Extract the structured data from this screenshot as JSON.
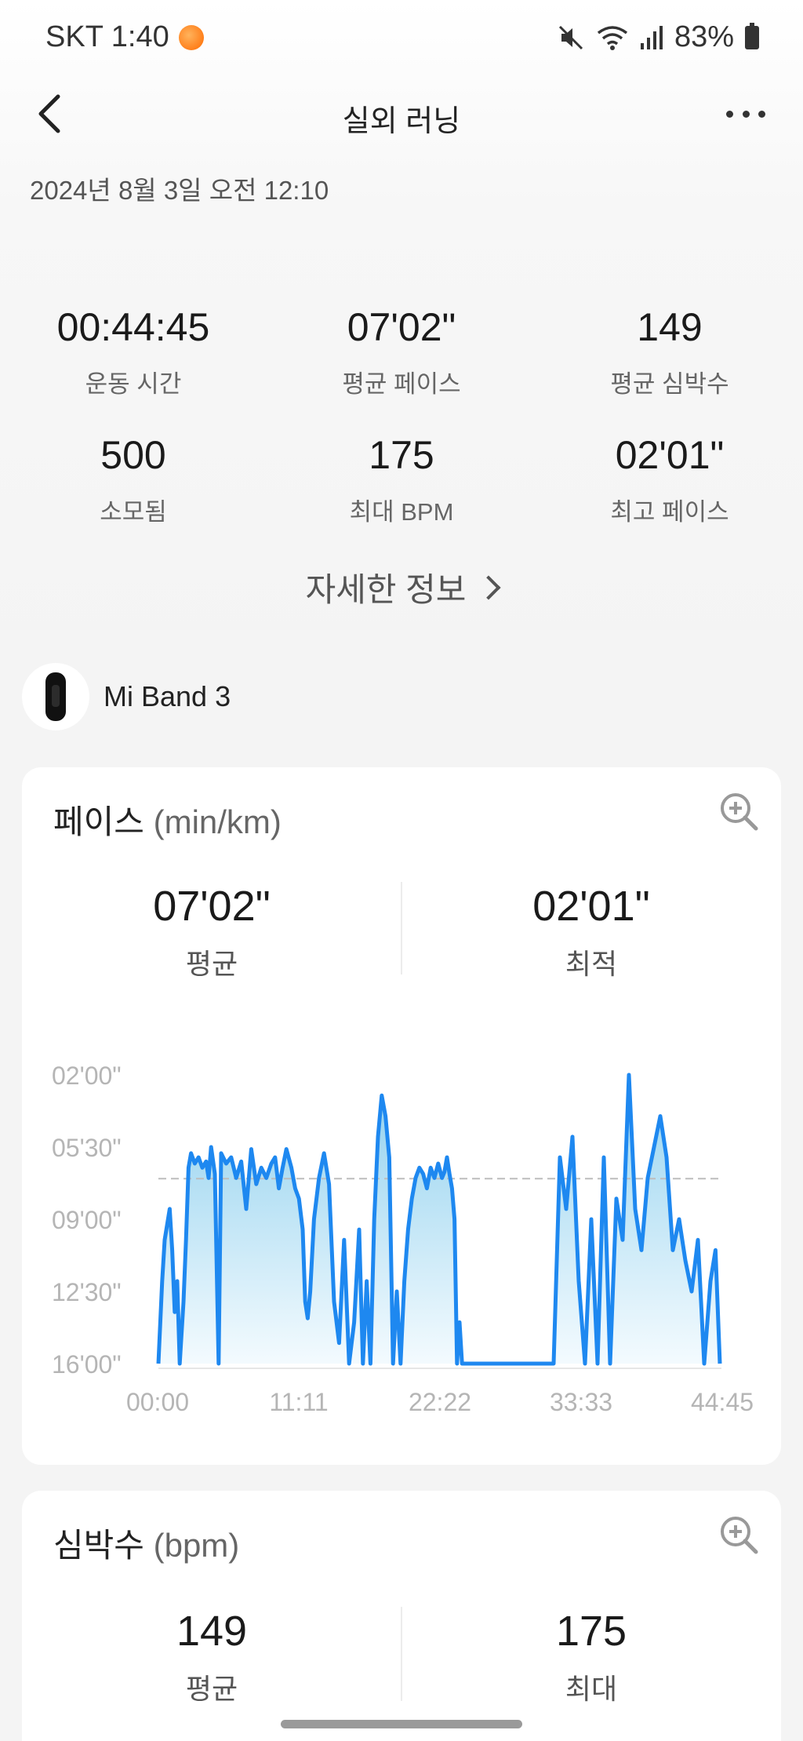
{
  "status_bar": {
    "carrier_time": "SKT 1:40",
    "battery": "83%"
  },
  "header": {
    "title": "실외 러닝"
  },
  "session": {
    "date": "2024년 8월 3일 오전 12:10"
  },
  "summary": [
    {
      "value": "00:44:45",
      "label": "운동 시간"
    },
    {
      "value": "07'02\"",
      "label": "평균 페이스"
    },
    {
      "value": "149",
      "label": "평균 심박수"
    },
    {
      "value": "500",
      "label": "소모됨"
    },
    {
      "value": "175",
      "label": "최대 BPM"
    },
    {
      "value": "02'01\"",
      "label": "최고 페이스"
    }
  ],
  "details_link": "자세한 정보",
  "device": {
    "name": "Mi Band 3"
  },
  "pace_card": {
    "title": "페이스",
    "unit": "(min/km)",
    "average": {
      "value": "07'02\"",
      "label": "평균"
    },
    "best": {
      "value": "02'01\"",
      "label": "최적"
    }
  },
  "hr_card": {
    "title": "심박수",
    "unit": "(bpm)",
    "average": {
      "value": "149",
      "label": "평균"
    },
    "max": {
      "value": "175",
      "label": "최대"
    }
  },
  "chart_data": {
    "type": "area",
    "xlabel": "",
    "ylabel": "",
    "x_tick_labels": [
      "00:00",
      "11:11",
      "22:22",
      "33:33",
      "44:45"
    ],
    "y_tick_labels": [
      "02'00\"",
      "05'30\"",
      "09'00\"",
      "12'30\"",
      "16'00\""
    ],
    "y_axis_reversed": true,
    "ylim_minutes_per_km": [
      2.0,
      16.0
    ],
    "xlim_minutes": [
      0,
      44.75
    ],
    "average_line_minutes_per_km": 7.03,
    "colors": {
      "line": "#1e88f0",
      "fill_top": "#8fd0ee",
      "fill_bottom": "#f2fafe",
      "average": "#bdbdbd"
    },
    "series": [
      {
        "x": [
          0.0,
          0.3,
          0.5,
          0.9,
          1.1,
          1.3,
          1.5,
          1.7,
          2.0,
          2.2,
          2.4,
          2.6,
          2.9,
          3.2,
          3.5,
          3.8,
          4.0,
          4.2,
          4.5,
          4.8,
          5.0,
          5.4,
          5.8,
          6.2,
          6.6,
          7.0,
          7.4,
          7.8,
          8.2,
          8.6,
          9.0,
          9.3,
          9.6,
          9.9,
          10.2,
          10.6,
          10.9,
          11.2,
          11.5,
          11.7,
          11.9,
          12.1,
          12.4,
          12.8,
          13.2,
          13.6,
          14.0,
          14.4,
          14.8,
          15.2,
          15.6,
          16.0,
          16.3,
          16.6,
          16.9,
          17.2,
          17.5,
          17.8,
          18.1,
          18.4,
          18.7,
          19.0,
          19.3,
          19.6,
          19.9,
          20.2,
          20.5,
          20.8,
          21.1,
          21.4,
          21.7,
          22.0,
          22.3,
          22.6,
          22.8,
          23.0,
          23.2,
          23.4,
          23.6,
          23.8,
          24.0,
          24.2,
          24.4,
          24.6,
          24.8,
          25.0,
          25.2
        ],
        "y": [
          16.0,
          12.0,
          10.0,
          8.5,
          10.5,
          13.5,
          12.0,
          16.0,
          13.0,
          10.0,
          6.5,
          5.8,
          6.3,
          6.0,
          6.5,
          6.2,
          7.0,
          5.5,
          6.8,
          16.0,
          5.8,
          6.3,
          6.0,
          7.0,
          6.2,
          8.5,
          5.6,
          7.3,
          6.5,
          7.0,
          6.3,
          6.0,
          7.5,
          6.5,
          5.6,
          6.5,
          7.5,
          8.0,
          9.5,
          13.0,
          13.8,
          12.5,
          9.0,
          7.0,
          5.8,
          7.3,
          13.0,
          15.0,
          10.0,
          16.0,
          14.0,
          9.5,
          16.0,
          12.0,
          16.0,
          9.0,
          5.0,
          3.0,
          4.0,
          6.0,
          16.0,
          12.5,
          16.0,
          12.0,
          9.5,
          8.0,
          7.0,
          6.5,
          6.8,
          7.5,
          6.5,
          7.0,
          6.3,
          7.0,
          6.7,
          6.0,
          6.8,
          7.5,
          9.0,
          16.0,
          14.0,
          16.0,
          16.0,
          16.0,
          16.0,
          16.0,
          16.0
        ]
      },
      {
        "x": [
          25.0,
          25.5,
          26.0,
          26.5,
          27.0,
          27.5,
          28.0,
          28.5,
          29.0,
          29.5,
          30.0,
          30.5,
          31.0,
          31.5,
          32.0,
          32.5,
          33.0,
          33.5,
          34.0,
          34.5,
          35.0,
          35.5,
          36.0,
          36.5,
          37.0,
          37.5,
          38.0,
          38.5,
          39.0,
          39.5,
          40.0,
          40.5,
          41.0,
          41.5,
          42.0,
          42.5,
          43.0,
          43.5,
          44.0,
          44.4,
          44.75
        ],
        "y": [
          16.0,
          16.0,
          16.0,
          16.0,
          16.0,
          16.0,
          16.0,
          16.0,
          16.0,
          16.0,
          16.0,
          16.0,
          16.0,
          16.0,
          6.0,
          8.5,
          5.0,
          12.0,
          16.0,
          9.0,
          16.0,
          6.0,
          16.0,
          8.0,
          10.0,
          2.0,
          8.5,
          10.5,
          7.0,
          5.5,
          4.0,
          6.0,
          10.5,
          9.0,
          11.0,
          12.5,
          10.0,
          16.0,
          12.0,
          10.5,
          16.0
        ]
      }
    ]
  }
}
